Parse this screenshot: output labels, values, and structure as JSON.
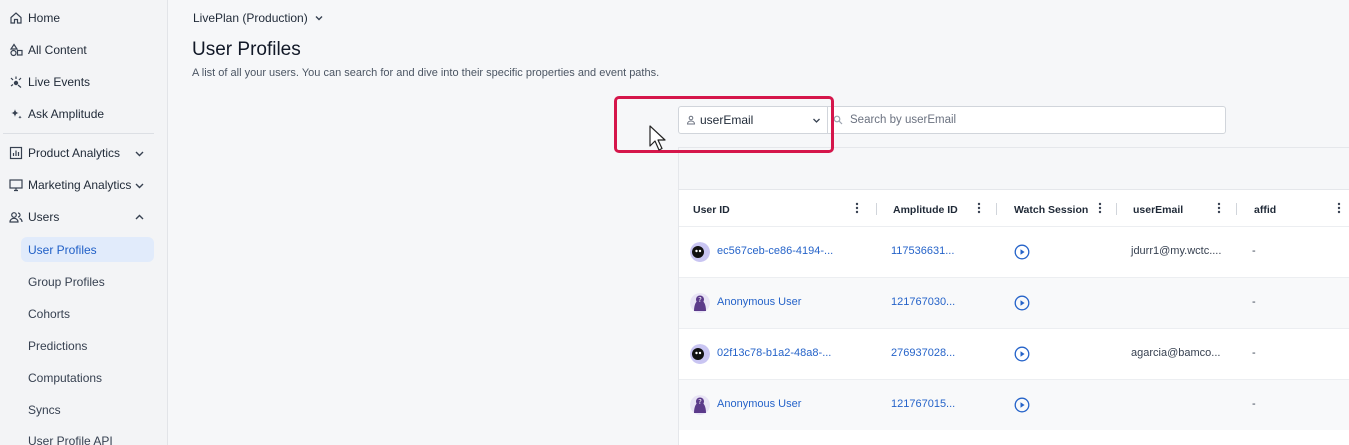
{
  "sidebar": {
    "items": [
      {
        "label": "Home",
        "icon": "home-icon"
      },
      {
        "label": "All Content",
        "icon": "shapes-icon"
      },
      {
        "label": "Live Events",
        "icon": "live-events-icon"
      },
      {
        "label": "Ask Amplitude",
        "icon": "sparkle-icon"
      }
    ],
    "sections": [
      {
        "label": "Product Analytics",
        "icon": "chart-icon",
        "expanded": false
      },
      {
        "label": "Marketing Analytics",
        "icon": "monitor-icon",
        "expanded": false
      },
      {
        "label": "Users",
        "icon": "users-icon",
        "expanded": true
      }
    ],
    "users_children": [
      {
        "label": "User Profiles",
        "active": true
      },
      {
        "label": "Group Profiles"
      },
      {
        "label": "Cohorts"
      },
      {
        "label": "Predictions"
      },
      {
        "label": "Computations"
      },
      {
        "label": "Syncs"
      },
      {
        "label": "User Profile API"
      }
    ]
  },
  "header": {
    "project": "LivePlan (Production)",
    "title": "User Profiles",
    "subtitle": "A list of all your users. You can search for and dive into their specific properties and event paths."
  },
  "search": {
    "property": "userEmail",
    "placeholder": "Search by userEmail",
    "value": ""
  },
  "table": {
    "columns": [
      "User ID",
      "Amplitude ID",
      "Watch Session",
      "userEmail",
      "affid"
    ],
    "rows": [
      {
        "user_id": "ec567ceb-ce86-4194-...",
        "amplitude_id": "117536631...",
        "user_email": "jdurr1@my.wctc....",
        "affid": "-",
        "avatar": "known"
      },
      {
        "user_id": "Anonymous User",
        "amplitude_id": "121767030...",
        "user_email": "",
        "affid": "-",
        "avatar": "anonymous"
      },
      {
        "user_id": "02f13c78-b1a2-48a8-...",
        "amplitude_id": "276937028...",
        "user_email": "agarcia@bamco...",
        "affid": "-",
        "avatar": "known"
      },
      {
        "user_id": "Anonymous User",
        "amplitude_id": "121767015...",
        "user_email": "",
        "affid": "-",
        "avatar": "anonymous"
      }
    ]
  },
  "colors": {
    "accent": "#2563c9",
    "active_bg": "#e1ebfb",
    "highlight": "#d5164b",
    "avatar_known": "#c9c5f2",
    "avatar_anonymous": "#5b3a8a"
  }
}
